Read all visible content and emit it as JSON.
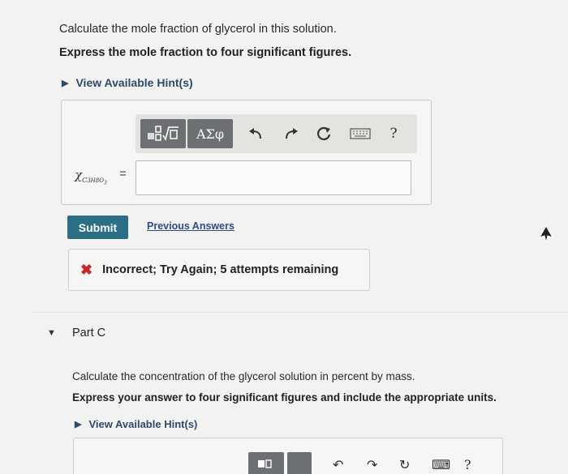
{
  "partB": {
    "question": "Calculate the mole fraction of glycerol in this solution.",
    "instruction": "Express the mole fraction to four significant figures.",
    "hint_label": "View Available Hint(s)",
    "toolbar": {
      "greek_label": "ΑΣφ",
      "help_label": "?",
      "icons": [
        "templates-icon",
        "greek-symbols-icon",
        "undo-icon",
        "redo-icon",
        "reset-icon",
        "keyboard-icon",
        "help-icon"
      ]
    },
    "variable": {
      "main": "χ",
      "sub1": "C",
      "sub2": "3H",
      "sub3": "8O",
      "sub4": "3",
      "equals": "="
    },
    "input_value": "",
    "submit_label": "Submit",
    "previous_answers_label": "Previous Answers",
    "feedback": {
      "icon": "x-icon",
      "message": "Incorrect; Try Again; 5 attempts remaining",
      "color": "#d32020"
    }
  },
  "partC": {
    "title": "Part C",
    "question": "Calculate the concentration of the glycerol solution in percent by mass.",
    "instruction": "Express your answer to four significant figures and include the appropriate units.",
    "hint_label": "View Available Hint(s)",
    "help_label": "?"
  },
  "colors": {
    "submit": "#2a6f86",
    "link": "#2d4a8a",
    "hint": "#2d4a6b",
    "toolbar_dark": "#6c7073"
  }
}
